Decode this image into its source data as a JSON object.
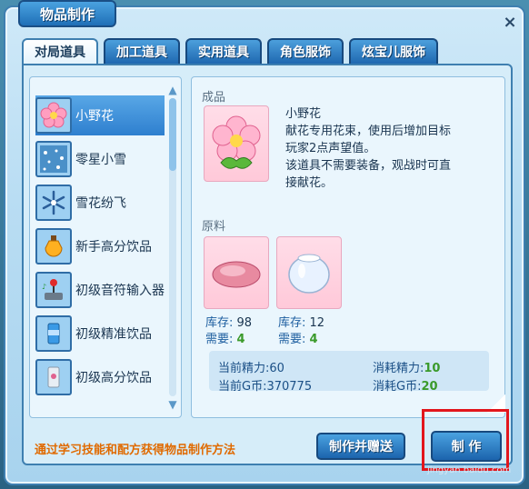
{
  "window": {
    "title": "物品制作",
    "close_label": "×"
  },
  "tabs": [
    {
      "label": "对局道具"
    },
    {
      "label": "加工道具"
    },
    {
      "label": "实用道具"
    },
    {
      "label": "角色服饰"
    },
    {
      "label": "炫宝儿服饰"
    }
  ],
  "item_list": {
    "items": [
      {
        "label": "小野花",
        "icon": "flower-icon"
      },
      {
        "label": "零星小雪",
        "icon": "snow-icon"
      },
      {
        "label": "雪花纷飞",
        "icon": "snowflake-icon"
      },
      {
        "label": "新手高分饮品",
        "icon": "potion-icon"
      },
      {
        "label": "初级音符输入器",
        "icon": "joystick-icon"
      },
      {
        "label": "初级精准饮品",
        "icon": "can-icon"
      },
      {
        "label": "初级高分饮品",
        "icon": "can-icon"
      }
    ]
  },
  "detail": {
    "product_label": "成品",
    "product_name": "小野花",
    "product_desc_1": "献花专用花束，使用后增加目标",
    "product_desc_2": "玩家2点声望值。",
    "product_desc_3": "该道具不需要装备，观战时可直",
    "product_desc_4": "接献花。",
    "material_label": "原料",
    "materials": [
      {
        "stock_label": "库存:",
        "stock": "98",
        "need_label": "需要:",
        "need": "4",
        "icon": "meat-icon"
      },
      {
        "stock_label": "库存:",
        "stock": "12",
        "need_label": "需要:",
        "need": "4",
        "icon": "glass-bowl-icon"
      }
    ],
    "stats": {
      "current_energy_label": "当前精力:",
      "current_energy": "60",
      "cost_energy_label": "消耗精力:",
      "cost_energy": "10",
      "current_g_label": "当前G币:",
      "current_g": "370775",
      "cost_g_label": "消耗G币:",
      "cost_g": "20"
    }
  },
  "footer": {
    "hint": "通过学习技能和配方获得物品制作方法",
    "gift_button": "制作并赠送",
    "make_button": "制 作"
  },
  "watermark": "jingyan.baidu.com",
  "colors": {
    "accent": "#2e7fcf",
    "highlight": "#e2161c",
    "hint": "#e06a00"
  }
}
